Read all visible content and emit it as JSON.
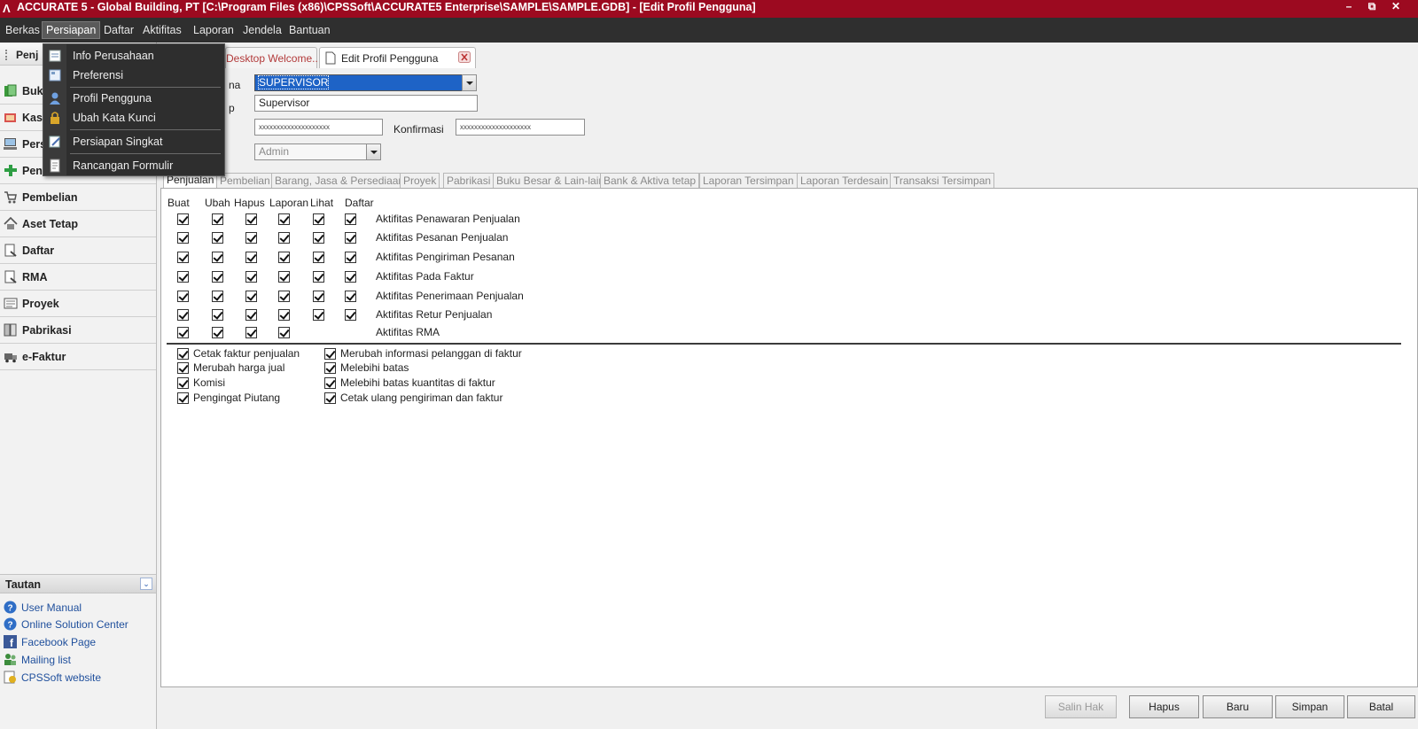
{
  "window": {
    "title": "ACCURATE 5  - Global Building, PT  [C:\\Program Files (x86)\\CPSSoft\\ACCURATE5 Enterprise\\SAMPLE\\SAMPLE.GDB] - [Edit Profil Pengguna]",
    "logo": "Λ",
    "controls": {
      "minimize": "–",
      "restore": "⧉",
      "close": "✕"
    }
  },
  "menubar": [
    "Berkas",
    "Persiapan",
    "Daftar",
    "Aktifitas",
    "Laporan",
    "Jendela",
    "Bantuan"
  ],
  "dropdown": {
    "items": [
      "Info Perusahaan",
      "Preferensi",
      "Profil Pengguna",
      "Ubah Kata Kunci",
      "Persiapan Singkat",
      "Rancangan Formulir"
    ]
  },
  "sidebar": {
    "header": "Penj",
    "nav": [
      "Buk",
      "Kas",
      "Pers",
      "Pen",
      "Pembelian",
      "Aset Tetap",
      "Daftar",
      "RMA",
      "Proyek",
      "Pabrikasi",
      "e-Faktur"
    ],
    "links_header": "Tautan",
    "links": [
      "User Manual",
      "Online Solution Center",
      "Facebook Page",
      "Mailing list",
      "CPSSoft website"
    ]
  },
  "doc_tabs": {
    "welcome": "Desktop Welcome...",
    "edit": "Edit Profil Pengguna"
  },
  "form": {
    "name_label": "na",
    "name_value": "SUPERVISOR",
    "full_label": "p",
    "full_value": "Supervisor",
    "password_value": "xxxxxxxxxxxxxxxxxxxx",
    "confirm_label": "Konfirmasi",
    "confirm_value": "xxxxxxxxxxxxxxxxxxxx",
    "group_value": "Admin"
  },
  "perm_tabs": [
    "Penjualan",
    "Pembelian",
    "Barang, Jasa & Persediaan",
    "Proyek",
    "Pabrikasi",
    "Buku Besar & Lain-lain",
    "Bank & Aktiva tetap",
    "Laporan Tersimpan",
    "Laporan Terdesain",
    "Transaksi Tersimpan"
  ],
  "columns": [
    "Buat",
    "Ubah",
    "Hapus",
    "Laporan",
    "Lihat",
    "Daftar"
  ],
  "rows": [
    {
      "label": "Aktifitas Penawaran Penjualan",
      "checks": [
        true,
        true,
        true,
        true,
        true,
        true
      ]
    },
    {
      "label": "Aktifitas Pesanan Penjualan",
      "checks": [
        true,
        true,
        true,
        true,
        true,
        true
      ]
    },
    {
      "label": "Aktifitas Pengiriman Pesanan",
      "checks": [
        true,
        true,
        true,
        true,
        true,
        true
      ]
    },
    {
      "label": "Aktifitas Pada Faktur",
      "checks": [
        true,
        true,
        true,
        true,
        true,
        true
      ]
    },
    {
      "label": "Aktifitas Penerimaan Penjualan",
      "checks": [
        true,
        true,
        true,
        true,
        true,
        true
      ]
    },
    {
      "label": "Aktifitas Retur Penjualan",
      "checks": [
        true,
        true,
        true,
        true,
        true,
        true
      ]
    },
    {
      "label": "Aktifitas RMA",
      "checks": [
        true,
        true,
        true,
        true,
        false,
        false
      ]
    }
  ],
  "options_left": [
    "Cetak faktur penjualan",
    "Merubah harga jual",
    "Komisi",
    "Pengingat Piutang"
  ],
  "options_right": [
    "Merubah informasi pelanggan di faktur",
    "Melebihi batas",
    "Melebihi batas kuantitas di faktur",
    "Cetak ulang pengiriman dan faktur"
  ],
  "buttons": {
    "copy": "Salin Hak",
    "delete": "Hapus",
    "new": "Baru",
    "save": "Simpan",
    "cancel": "Batal"
  },
  "colors": {
    "titlebar": "#9c0a20",
    "menubar": "#2f2f2f",
    "selection": "#1e63c6",
    "link": "#1f4f9c"
  }
}
